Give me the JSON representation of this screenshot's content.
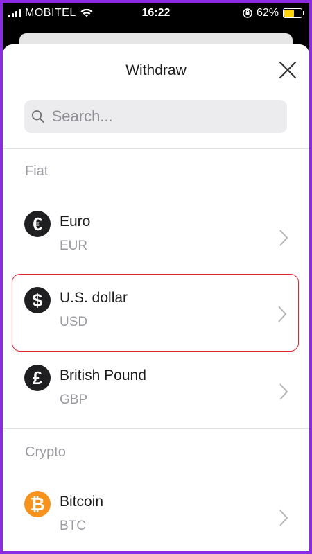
{
  "status_bar": {
    "carrier": "MOBITEL",
    "time": "16:22",
    "battery": "62%",
    "battery_level": 0.62,
    "battery_color": "#ffd60a"
  },
  "sheet": {
    "title": "Withdraw",
    "search_placeholder": "Search..."
  },
  "sections": [
    {
      "label": "Fiat",
      "items": [
        {
          "name": "Euro",
          "code": "EUR",
          "symbol": "€",
          "icon": "euro-icon"
        },
        {
          "name": "U.S. dollar",
          "code": "USD",
          "symbol": "$",
          "icon": "dollar-icon",
          "selected": true
        },
        {
          "name": "British Pound",
          "code": "GBP",
          "symbol": "£",
          "icon": "pound-icon"
        }
      ]
    },
    {
      "label": "Crypto",
      "items": [
        {
          "name": "Bitcoin",
          "code": "BTC",
          "symbol": "₿",
          "icon": "bitcoin-icon",
          "color": "#f7931a"
        }
      ]
    }
  ],
  "colors": {
    "selection_border": "#e0242f",
    "frame": "#8a2be2"
  }
}
